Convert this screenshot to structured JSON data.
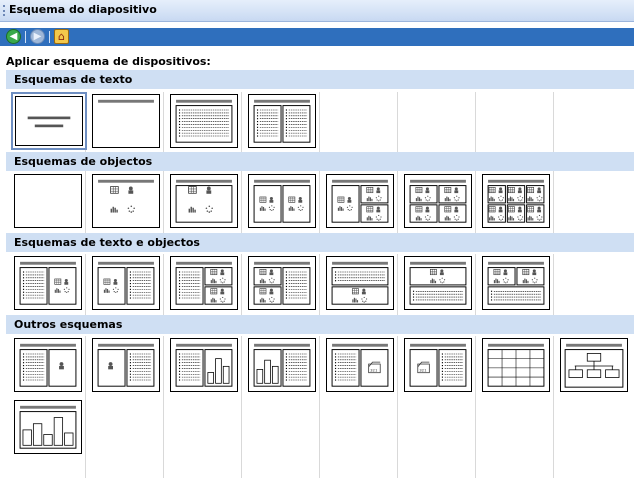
{
  "pane": {
    "title": "Esquema do diapositivo"
  },
  "nav": {
    "back": "◀",
    "forward": "▶",
    "home": "⌂"
  },
  "apply_label": "Aplicar esquema de dispositivos:",
  "sections": [
    {
      "title": "Esquemas de texto",
      "layouts": [
        "title-slide",
        "title-only",
        "title-text",
        "title-two-text"
      ]
    },
    {
      "title": "Esquemas de objectos",
      "layouts": [
        "blank",
        "title-objects-4",
        "title-objects-3",
        "title-4-content-wide",
        "title-4-content-grid",
        "title-2-charts-2-content",
        "title-6-content"
      ]
    },
    {
      "title": "Esquemas de texto e objectos",
      "layouts": [
        "text-and-objects",
        "objects-and-text",
        "text-and-content",
        "content-and-text",
        "text-over-content",
        "content-over-text",
        "content-over-text-2"
      ]
    },
    {
      "title": "Outros esquemas",
      "layouts": [
        "text-and-clipart",
        "clipart-and-text",
        "text-and-chart",
        "chart-and-text",
        "text-and-media",
        "media-and-text",
        "title-table",
        "title-orgchart",
        "title-chart"
      ]
    }
  ]
}
